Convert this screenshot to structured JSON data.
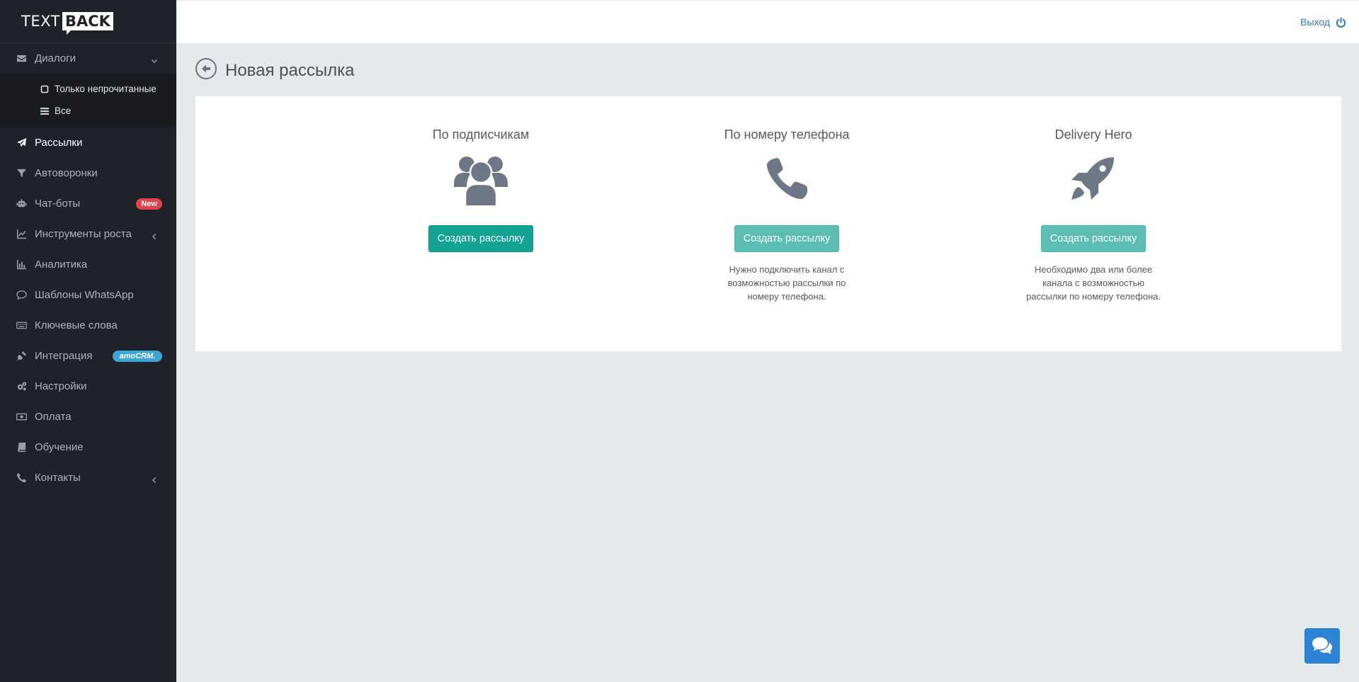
{
  "logo": {
    "text": "TEXT",
    "box": "BACK"
  },
  "sidebar": {
    "items": [
      {
        "label": "Диалоги",
        "icon": "envelope-icon"
      },
      {
        "label": "Рассылки",
        "icon": "paper-plane-icon"
      },
      {
        "label": "Автоворонки",
        "icon": "filter-icon"
      },
      {
        "label": "Чат-боты",
        "icon": "robot-icon",
        "badge": "New"
      },
      {
        "label": "Инструменты роста",
        "icon": "line-chart-icon"
      },
      {
        "label": "Аналитика",
        "icon": "bar-chart-icon"
      },
      {
        "label": "Шаблоны WhatsApp",
        "icon": "comment-icon"
      },
      {
        "label": "Ключевые слова",
        "icon": "keyboard-icon"
      },
      {
        "label": "Интеграция",
        "icon": "plug-icon",
        "badge": "amoCRM."
      },
      {
        "label": "Настройки",
        "icon": "gears-icon"
      },
      {
        "label": "Оплата",
        "icon": "money-icon"
      },
      {
        "label": "Обучение",
        "icon": "book-icon"
      },
      {
        "label": "Контакты",
        "icon": "phone-icon"
      }
    ],
    "submenu": [
      {
        "label": "Только непрочитанные",
        "icon": "square-icon"
      },
      {
        "label": "Все",
        "icon": "list-icon"
      }
    ]
  },
  "topbar": {
    "logout_label": "Выход"
  },
  "page": {
    "title": "Новая рассылка"
  },
  "options": [
    {
      "title": "По подписчикам",
      "icon": "users-icon",
      "button": "Создать рассылку",
      "enabled": true,
      "note": ""
    },
    {
      "title": "По номеру телефона",
      "icon": "phone-icon",
      "button": "Создать рассылку",
      "enabled": false,
      "note": "Нужно подключить канал с возможностью рассылки по номеру телефона."
    },
    {
      "title": "Delivery Hero",
      "icon": "rocket-icon",
      "button": "Создать рассылку",
      "enabled": false,
      "note": "Необходимо два или более канала с возможностью рассылки по номеру телефона."
    }
  ],
  "colors": {
    "accent": "#12a394",
    "accent_disabled": "#5cbdb2",
    "sidebar_bg": "#1f2229",
    "badge_new": "#e2434a",
    "badge_amo": "#3aa6d8",
    "link": "#337ab7"
  }
}
